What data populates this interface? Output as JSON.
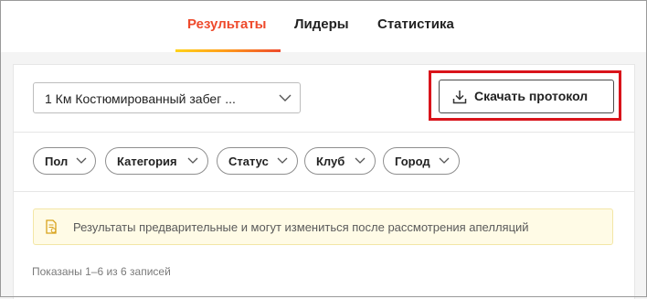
{
  "tabs": [
    {
      "label": "Результаты",
      "active": true
    },
    {
      "label": "Лидеры",
      "active": false
    },
    {
      "label": "Статистика",
      "active": false
    }
  ],
  "colors": {
    "accent": "#ee4a2c",
    "highlight_border": "#d9141b",
    "notice_bg": "#fffbe6"
  },
  "race_select": {
    "value": "1 Км Костюмированный забег ...",
    "icon": "chevron-down-icon"
  },
  "download_button": {
    "label": "Скачать протокол",
    "icon": "download-icon"
  },
  "filters": [
    {
      "label": "Пол"
    },
    {
      "label": "Категория"
    },
    {
      "label": "Статус"
    },
    {
      "label": "Клуб"
    },
    {
      "label": "Город"
    }
  ],
  "notice": {
    "text": "Результаты предварительные и могут измениться после рассмотрения апелляций",
    "icon": "document-warning-icon"
  },
  "results_count": "Показаны 1–6 из 6 записей"
}
